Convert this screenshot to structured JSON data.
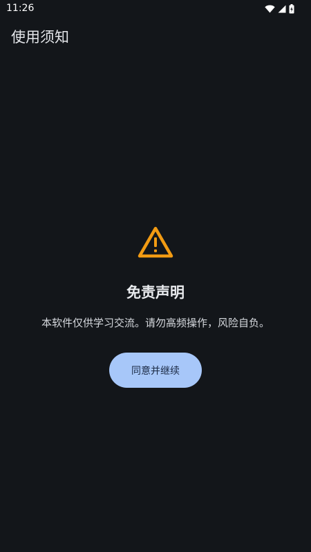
{
  "status_bar": {
    "time": "11:26",
    "icons": [
      "wifi-icon",
      "cellular-signal-icon",
      "battery-charging-icon"
    ]
  },
  "app": {
    "title": "使用须知"
  },
  "disclaimer": {
    "icon": "warning-icon",
    "icon_color": "#f29b13",
    "heading": "免责声明",
    "message": "本软件仅供学习交流。请勿高频操作，风险自负。",
    "button_label": "同意并继续"
  },
  "colors": {
    "background": "#13161a",
    "button_bg": "#a7c7f9",
    "button_text": "#1b2a44"
  }
}
